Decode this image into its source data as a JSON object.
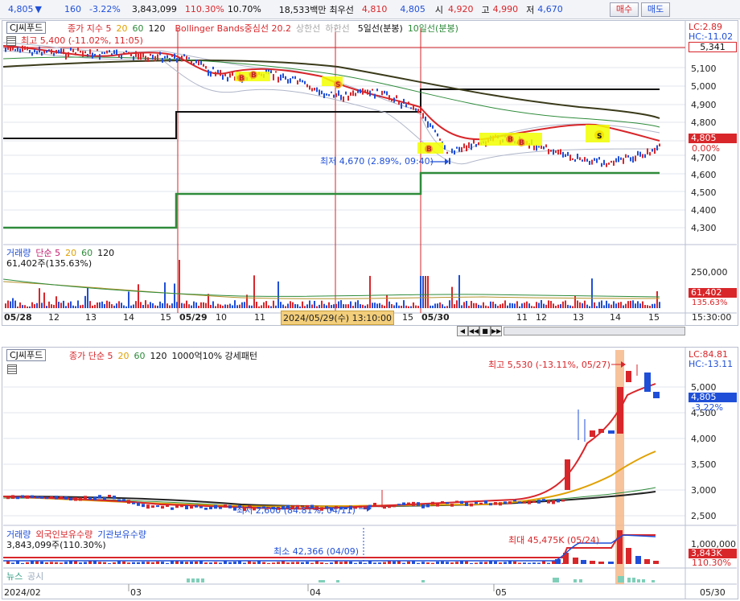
{
  "quote": {
    "price": "4,805",
    "change_arrow": "▼",
    "change": "160",
    "change_pct": "-3.22%",
    "volume": "3,843,099",
    "vol_ratio": "110.30%",
    "turnover": "10.70%",
    "amount": "18,533백만",
    "best_ask_label": "최우선",
    "best_ask": "4,810",
    "best_bid": "4,805",
    "open_label": "시",
    "open": "4,920",
    "high_label": "고",
    "high": "4,990",
    "low_label": "저",
    "low": "4,670",
    "buy_label": "매수",
    "sell_label": "매도"
  },
  "intraday": {
    "ticker": "CJ씨푸드",
    "legend": [
      "종가 지수 5",
      "20",
      "60",
      "120",
      "Bollinger Bands중심선 20.2",
      "상한선",
      "하한선",
      "5일선(분봉)",
      "10일선(분봉)"
    ],
    "lc": "LC:2.89",
    "hc": "HC:-11.02",
    "high_note": "최고 5,400 (-11.02%, 11:05)",
    "low_note": "최저 4,670 (2.89%, 09:40)",
    "price_ticks": [
      "5,100",
      "5,000",
      "4,900",
      "4,800",
      "4,700",
      "4,600",
      "4,500",
      "4,400",
      "4,300"
    ],
    "box_5341": "5,341",
    "box_price": "4,805",
    "box_pct": "0.00%",
    "volume_legend": [
      "거래량",
      "단순 5",
      "20",
      "60",
      "120"
    ],
    "volume_total": "61,402주(135.63%)",
    "volume_ticks": [
      "250,000"
    ],
    "volume_box": "61,402",
    "volume_box_pct": "135.63%",
    "time_labels": [
      "05/28",
      "12",
      "13",
      "14",
      "15",
      "05/29",
      "10",
      "11",
      "12",
      "13",
      "14",
      "15",
      "05/30",
      "10",
      "11",
      "12",
      "13",
      "14",
      "15"
    ],
    "cursor_label": "2024/05/29(수) 13:10:00",
    "clock": "15:30:00",
    "nav_buttons": [
      "◀",
      "◀◀",
      "■",
      "▶▶"
    ]
  },
  "daily": {
    "ticker": "CJ씨푸드",
    "legend": [
      "종가 단순 5",
      "20",
      "60",
      "120",
      "1000억10% 강세패턴"
    ],
    "lc": "LC:84.81",
    "hc": "HC:-13.11",
    "high_note": "최고 5,530 (-13.11%, 05/27)",
    "low_note": "최저 2,600 (84.81%, 04/11)",
    "price_ticks": [
      "5,000",
      "4,500",
      "4,000",
      "3,500",
      "3,000",
      "2,500"
    ],
    "box_price": "4,805",
    "box_pct": "-3.22%",
    "volume_legend": [
      "거래량",
      "외국인보유수량",
      "기관보유수량"
    ],
    "volume_total": "3,843,099주(110.30%)",
    "vol_min_note": "최소 42,366 (04/09)",
    "vol_max_note": "최대 45,475K (05/24)",
    "volume_ticks": [
      "1,000,000"
    ],
    "volume_box": "3,843K",
    "volume_box_pct": "110.30%",
    "news_label": "뉴스",
    "disclosure_label": "공시",
    "date_labels": [
      "2024/02",
      "03",
      "04",
      "05"
    ],
    "end_date": "05/30"
  },
  "colors": {
    "up": "#d8262a",
    "down": "#1f4fd8",
    "ma5": "#d8262a",
    "ma20": "#e0a000",
    "ma60": "#2e8b3a",
    "ma120": "#222222",
    "highlight": "#f2ff00",
    "band": "#f6b88a"
  }
}
